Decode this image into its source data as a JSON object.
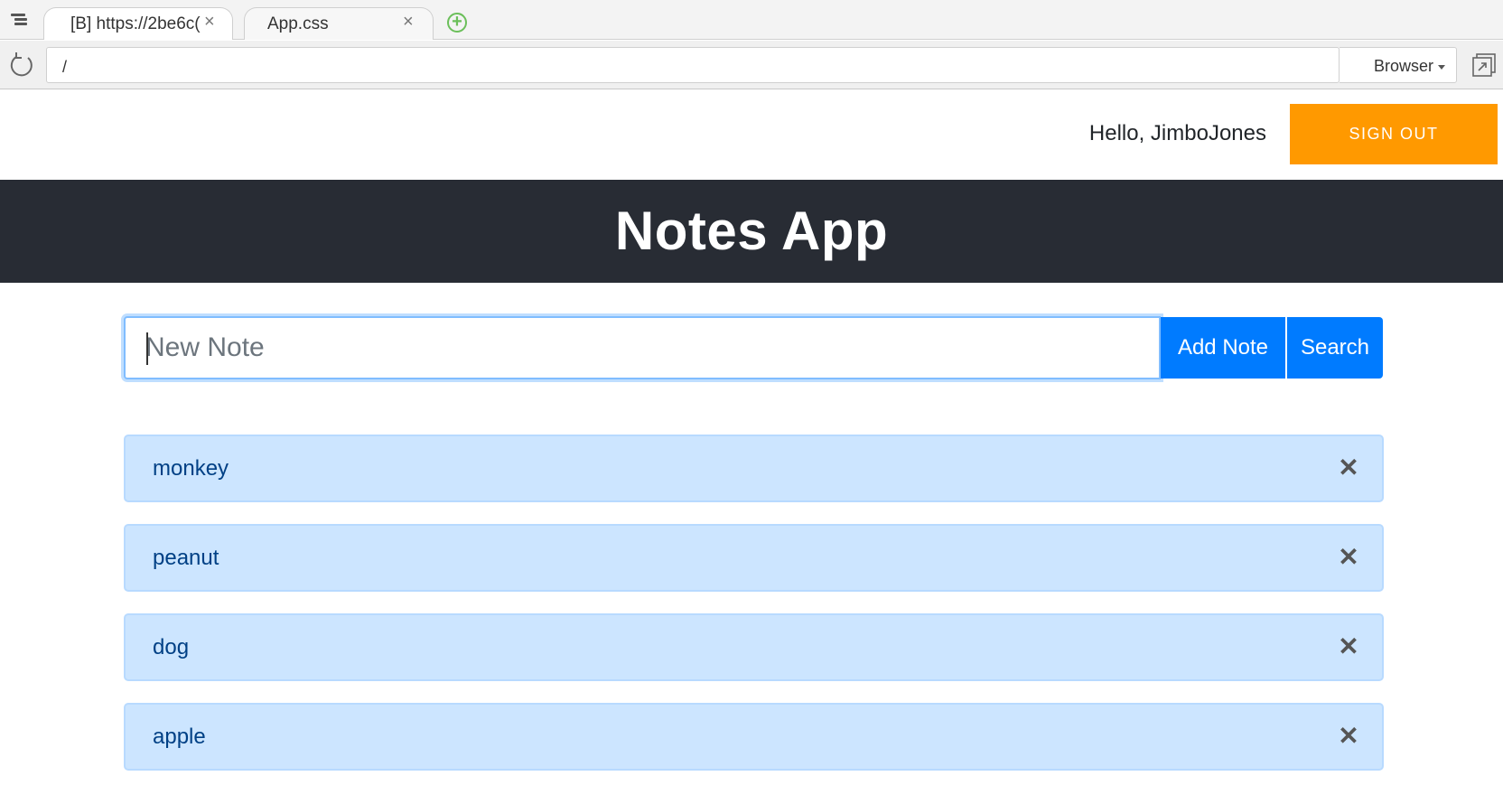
{
  "browser": {
    "tabs": [
      {
        "label": "[B] https://2be6c(",
        "close": "×"
      },
      {
        "label": "App.css",
        "close": "×"
      }
    ],
    "new_tab_symbol": "+",
    "url": "/",
    "browser_select": "Browser"
  },
  "header": {
    "greeting": "Hello, JimboJones",
    "sign_out": "SIGN OUT"
  },
  "banner": {
    "title": "Notes App"
  },
  "form": {
    "placeholder": "New Note",
    "add_label": "Add Note",
    "search_label": "Search"
  },
  "notes": [
    {
      "text": "monkey",
      "delete": "✕"
    },
    {
      "text": "peanut",
      "delete": "✕"
    },
    {
      "text": "dog",
      "delete": "✕"
    },
    {
      "text": "apple",
      "delete": "✕"
    }
  ],
  "colors": {
    "banner_bg": "#282c34",
    "sign_out_bg": "#ff9900",
    "primary_button": "#007bff",
    "note_bg": "#cce5ff",
    "note_text": "#004085"
  },
  "icons": [
    "tabs-menu-icon",
    "close-icon",
    "new-tab-icon",
    "reload-icon",
    "chevron-down-icon",
    "popout-icon",
    "delete-icon"
  ]
}
